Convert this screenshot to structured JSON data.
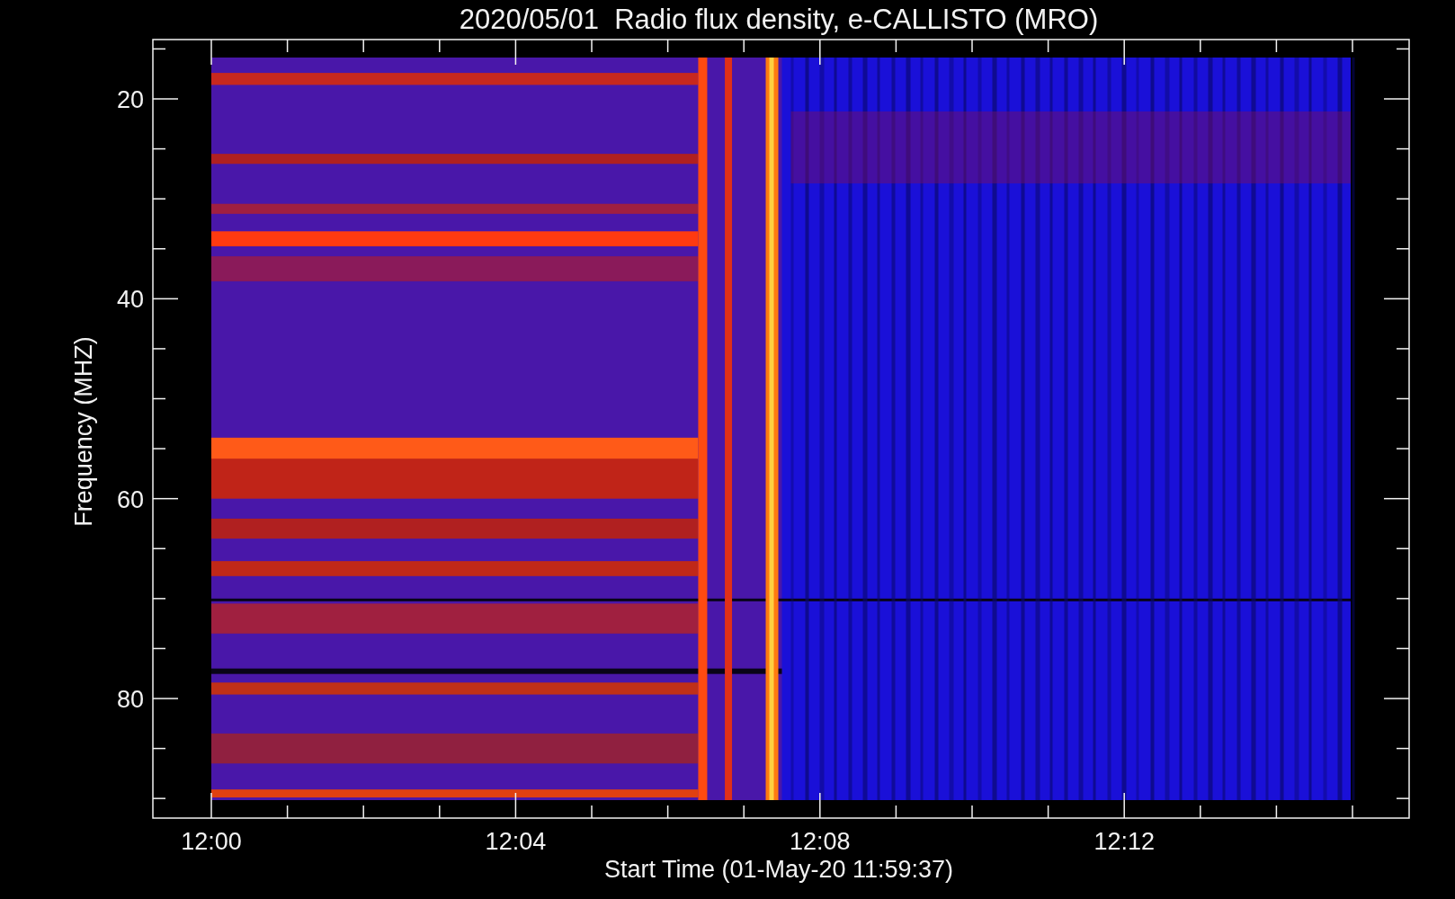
{
  "title": "2020/05/01  Radio flux density, e-CALLISTO (MRO)",
  "y_axis": {
    "label": "Frequency (MHZ)",
    "ticks": [
      "20",
      "40",
      "60",
      "80"
    ]
  },
  "x_axis": {
    "label": "Start Time (01-May-20 11:59:37)",
    "ticks": [
      "12:00",
      "12:04",
      "12:08",
      "12:12"
    ]
  }
}
